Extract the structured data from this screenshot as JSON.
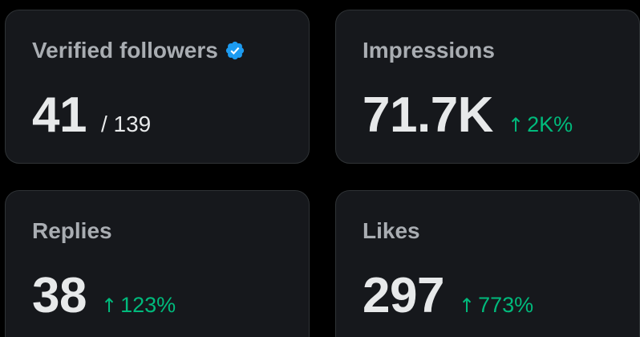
{
  "cards": {
    "verified": {
      "label": "Verified followers",
      "value": "41",
      "total": "/ 139",
      "badge_icon": "verified-badge-icon",
      "badge_color": "#1d9bf0"
    },
    "impressions": {
      "label": "Impressions",
      "value": "71.7K",
      "delta": "2K%",
      "delta_icon": "arrow-up-icon"
    },
    "replies": {
      "label": "Replies",
      "value": "38",
      "delta": "123%",
      "delta_icon": "arrow-up-icon"
    },
    "likes": {
      "label": "Likes",
      "value": "297",
      "delta": "773%",
      "delta_icon": "arrow-up-icon"
    }
  },
  "colors": {
    "background": "#000000",
    "card": "#16181c",
    "border": "#2f3336",
    "label": "#a9adb2",
    "value": "#e7e9ea",
    "positive": "#00ba7c",
    "verified": "#1d9bf0"
  }
}
